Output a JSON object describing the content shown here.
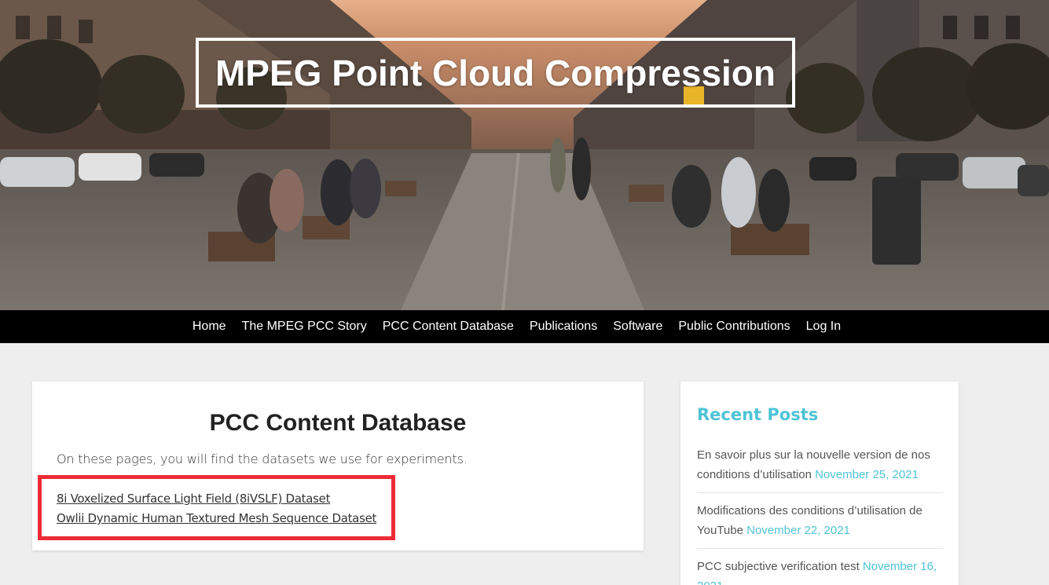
{
  "site": {
    "title": "MPEG Point Cloud Compression"
  },
  "nav": {
    "items": [
      "Home",
      "The MPEG PCC Story",
      "PCC Content Database",
      "Publications",
      "Software",
      "Public Contributions",
      "Log In"
    ]
  },
  "page": {
    "heading": "PCC Content Database",
    "intro": "On these pages, you will find the datasets we use for experiments.",
    "links": [
      "8i Voxelized Surface Light Field (8iVSLF) Dataset",
      "Owlii Dynamic Human Textured Mesh Sequence Dataset"
    ]
  },
  "sidebar": {
    "heading": "Recent Posts",
    "posts": [
      {
        "title": "En savoir plus sur la nouvelle version de nos conditions d’utilisation",
        "date": "November 25, 2021"
      },
      {
        "title": "Modifications des conditions d’utilisation de YouTube",
        "date": "November 22, 2021"
      },
      {
        "title": "PCC subjective verification test",
        "date": "November 16, 2021"
      }
    ]
  },
  "colors": {
    "accent": "#4fc3d5",
    "highlight": "#ee2c35",
    "nav_bg": "#000000"
  }
}
